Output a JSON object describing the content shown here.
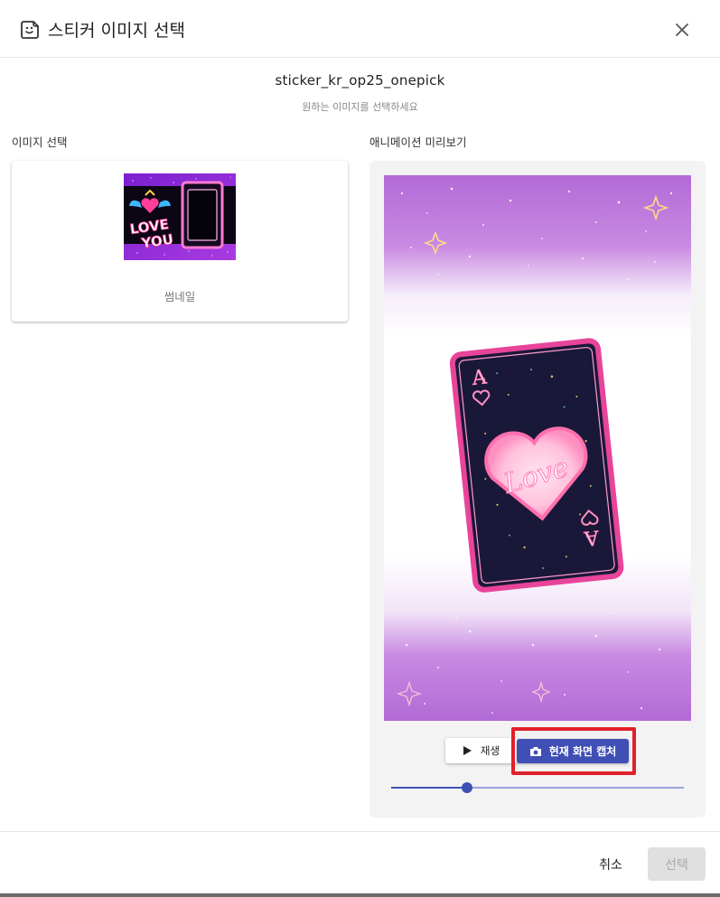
{
  "header": {
    "title": "스티커 이미지 선택",
    "icon": "sticker-icon",
    "close_icon": "close-icon"
  },
  "file": {
    "name": "sticker_kr_op25_onepick",
    "hint": "원하는 이미지를 선택하세요"
  },
  "left_section": {
    "label": "이미지 선택",
    "thumbnail_caption": "썸네일",
    "thumbnail_text_line1": "LOVE",
    "thumbnail_text_line2": "YOU"
  },
  "right_section": {
    "label": "애니메이션 미리보기",
    "card_rank": "A",
    "card_text": "Love"
  },
  "controls": {
    "play_label": "재생",
    "play_icon": "play-icon",
    "capture_label": "현재 화면 캡처",
    "capture_icon": "camera-icon",
    "progress": 0.26
  },
  "footer": {
    "cancel_label": "취소",
    "select_label": "선택"
  },
  "colors": {
    "accent": "#3f4fb5",
    "highlight": "#e0202a",
    "background_purple": "#b46bd6",
    "card_border": "#e8449a"
  }
}
